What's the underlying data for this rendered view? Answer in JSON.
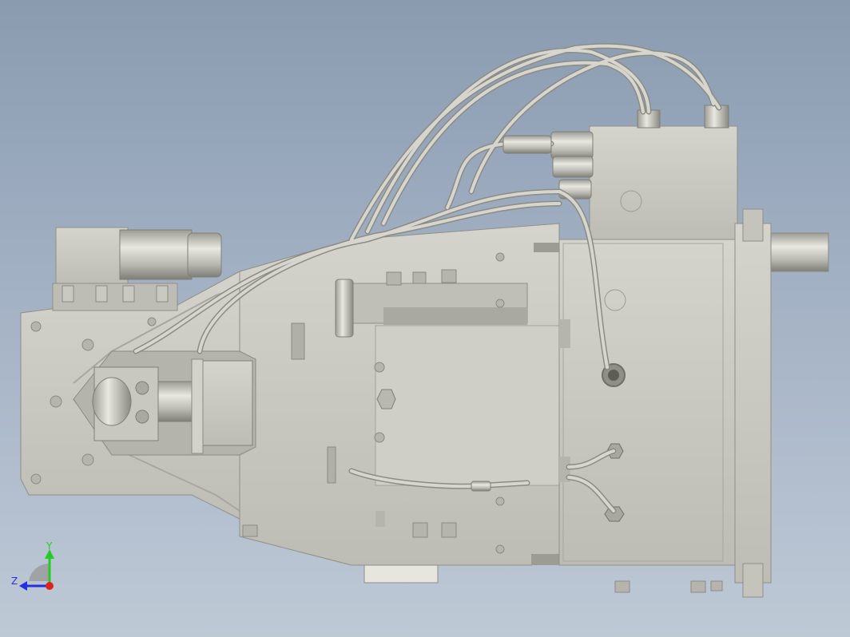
{
  "viewport": {
    "background_top": "#8a9bb0",
    "background_bottom": "#bec9d6",
    "part_color": "#c9c9c1",
    "part_shadow_color": "#9a9a92",
    "hose_color": "#bdbdb5"
  },
  "triad": {
    "y_label": "Y",
    "z_label": "Z",
    "y_color": "#22cc22",
    "z_color": "#2233dd",
    "x_color": "#dd2222"
  }
}
